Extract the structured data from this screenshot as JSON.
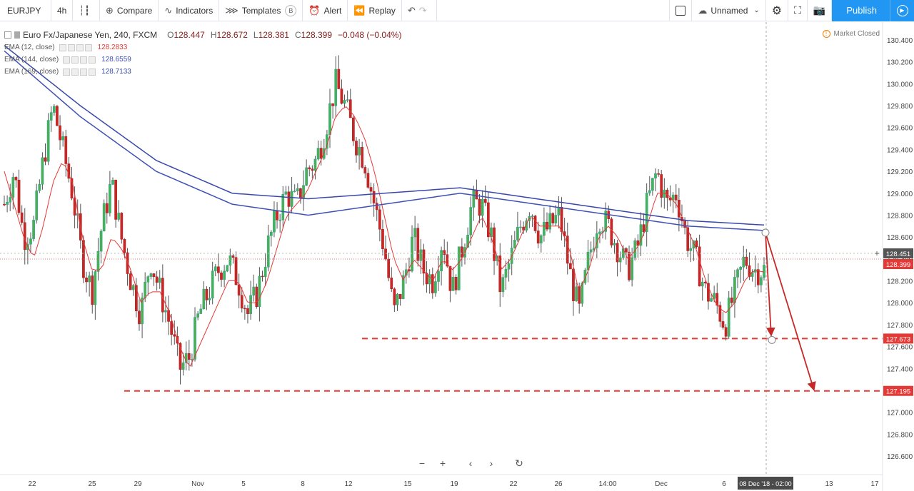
{
  "toolbar": {
    "symbol": "EURJPY",
    "interval": "4h",
    "compare": "Compare",
    "indicators": "Indicators",
    "templates": "Templates",
    "templates_badge": "B",
    "alert": "Alert",
    "replay": "Replay",
    "layout_name": "Unnamed",
    "publish": "Publish"
  },
  "legend": {
    "title": "Euro Fx/Japanese Yen, 240, FXCM",
    "open_label": "O",
    "open": "128.447",
    "high_label": "H",
    "high": "128.672",
    "low_label": "L",
    "low": "128.381",
    "close_label": "C",
    "close": "128.399",
    "change": "−0.048 (−0.04%)",
    "indicators": [
      {
        "name": "EMA (12, close)",
        "value": "128.2833",
        "color": "#e53935"
      },
      {
        "name": "EMA (144, close)",
        "value": "128.6559",
        "color": "#3f51b5"
      },
      {
        "name": "EMA (169, close)",
        "value": "128.7133",
        "color": "#3949ab"
      }
    ]
  },
  "market_status": "Market Closed",
  "chart_data": {
    "type": "candlestick",
    "y_axis": {
      "min": 126.5,
      "max": 130.5,
      "ticks": [
        "130.400",
        "130.200",
        "130.000",
        "129.800",
        "129.600",
        "129.400",
        "129.200",
        "129.000",
        "128.800",
        "128.600",
        "128.400",
        "128.200",
        "128.000",
        "127.800",
        "127.600",
        "127.400",
        "127.200",
        "127.000",
        "126.800",
        "126.600"
      ]
    },
    "x_ticks": [
      "22",
      "25",
      "29",
      "Nov",
      "5",
      "8",
      "12",
      "15",
      "19",
      "22",
      "26",
      "14:00",
      "Dec",
      "6",
      "13",
      "17"
    ],
    "crosshair_date": "08 Dec '18 - 02:00",
    "price_labels": [
      {
        "value": "128.451",
        "color": "#555555"
      },
      {
        "value": "128.399",
        "color": "#e53935"
      },
      {
        "value": "127.673",
        "color": "#e53935"
      },
      {
        "value": "127.195",
        "color": "#e53935"
      }
    ],
    "horizontal_levels": [
      127.673,
      127.195
    ],
    "close_path": [
      128.9,
      129.2,
      128.6,
      128.7,
      129.3,
      129.8,
      129.4,
      129.0,
      128.4,
      128.1,
      128.7,
      129.1,
      128.6,
      128.2,
      127.9,
      128.4,
      128.1,
      127.8,
      127.4,
      127.5,
      127.9,
      128.1,
      128.3,
      128.4,
      128.2,
      127.9,
      128.1,
      128.5,
      128.8,
      129.0,
      128.9,
      129.2,
      129.3,
      129.6,
      130.0,
      129.8,
      129.5,
      129.3,
      128.9,
      128.5,
      127.9,
      128.2,
      128.6,
      128.3,
      128.2,
      128.6,
      128.1,
      128.5,
      128.9,
      128.9,
      128.6,
      128.1,
      128.4,
      128.7,
      128.9,
      128.6,
      128.7,
      128.8,
      128.3,
      127.9,
      128.4,
      128.8,
      128.7,
      128.5,
      128.3,
      128.5,
      128.9,
      129.2,
      128.9,
      129.0,
      128.6,
      128.4,
      128.1,
      128.0,
      127.8,
      128.1,
      128.4,
      128.3,
      128.3
    ],
    "ema12_path": [
      129.2,
      128.9,
      128.6,
      128.4,
      128.7,
      129.1,
      129.3,
      129.1,
      128.6,
      128.3,
      128.3,
      128.6,
      128.5,
      128.3,
      128.0,
      128.1,
      128.1,
      127.9,
      127.6,
      127.4,
      127.6,
      127.8,
      128.0,
      128.2,
      128.2,
      128.0,
      128.0,
      128.2,
      128.5,
      128.8,
      128.9,
      129.0,
      129.2,
      129.4,
      129.7,
      129.8,
      129.7,
      129.5,
      129.2,
      128.8,
      128.4,
      128.2,
      128.4,
      128.3,
      128.2,
      128.4,
      128.3,
      128.4,
      128.6,
      128.8,
      128.6,
      128.3,
      128.4,
      128.6,
      128.8,
      128.7,
      128.7,
      128.7,
      128.5,
      128.1,
      128.3,
      128.6,
      128.7,
      128.6,
      128.4,
      128.5,
      128.7,
      129.0,
      129.0,
      128.9,
      128.7,
      128.5,
      128.2,
      128.0,
      127.9,
      128.0,
      128.2,
      128.3,
      128.28
    ],
    "ema144_path": [
      130.3,
      129.7,
      129.2,
      128.9,
      128.8,
      128.9,
      129.0,
      128.9,
      128.8,
      128.7,
      128.66
    ],
    "ema169_path": [
      130.35,
      129.8,
      129.3,
      129.0,
      128.95,
      129.0,
      129.05,
      128.95,
      128.85,
      128.75,
      128.71
    ]
  }
}
